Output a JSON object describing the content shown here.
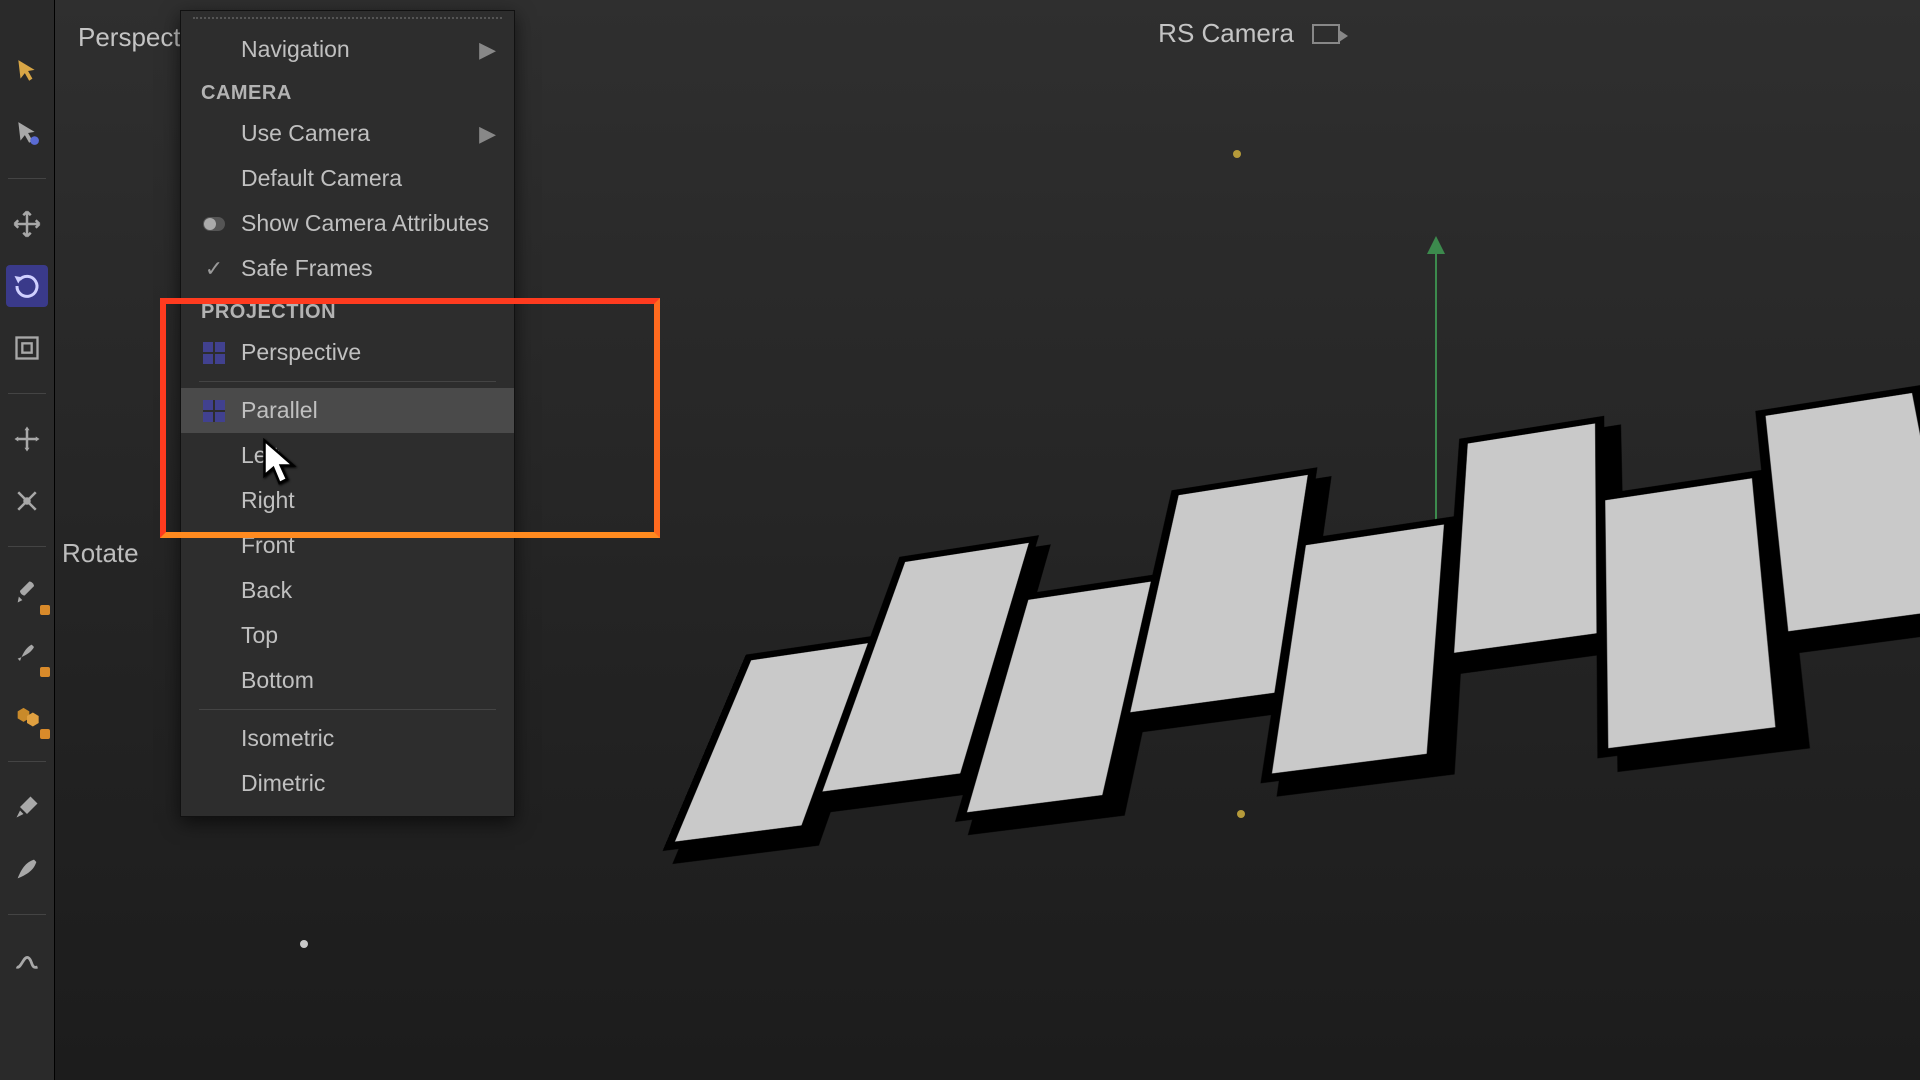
{
  "view": {
    "label": "Perspective"
  },
  "camera_label": "RS Camera",
  "rotate_label": "Rotate",
  "menu": {
    "navigation": "Navigation",
    "camera_header": "CAMERA",
    "use_camera": "Use Camera",
    "default_camera": "Default Camera",
    "show_camera_attrs": "Show Camera Attributes",
    "safe_frames": "Safe Frames",
    "projection_header": "PROJECTION",
    "perspective": "Perspective",
    "parallel": "Parallel",
    "left": "Left",
    "right": "Right",
    "front": "Front",
    "back": "Back",
    "top": "Top",
    "bottom": "Bottom",
    "isometric": "Isometric",
    "dimetric": "Dimetric"
  }
}
